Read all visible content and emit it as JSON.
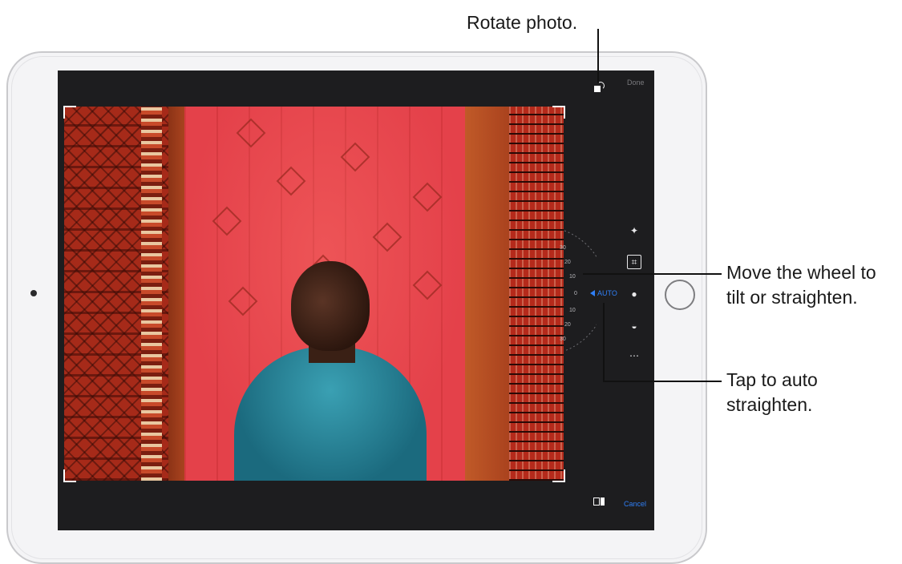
{
  "callouts": {
    "rotate": "Rotate photo.",
    "wheel_line1": "Move the wheel to",
    "wheel_line2": "tilt or straighten.",
    "auto_line1": "Tap to auto",
    "auto_line2": "straighten."
  },
  "toolbar": {
    "done_label": "Done",
    "cancel_label": "Cancel",
    "auto_label": "AUTO",
    "rotate_icon": "rotate-icon",
    "aspect_icon": "aspect-ratio-icon"
  },
  "side_tools": [
    {
      "name": "magic-wand-icon",
      "glyph": "✦"
    },
    {
      "name": "crop-icon",
      "glyph": "⌗"
    },
    {
      "name": "filters-icon",
      "glyph": "●"
    },
    {
      "name": "adjust-icon",
      "glyph": "◒"
    },
    {
      "name": "more-icon",
      "glyph": "⋯"
    }
  ],
  "straighten_wheel": {
    "ticks": [
      "30",
      "20",
      "10",
      "0",
      "10",
      "20",
      "30"
    ]
  },
  "colors": {
    "accent": "#2f7ff6",
    "screen_bg": "#1d1d1f"
  }
}
